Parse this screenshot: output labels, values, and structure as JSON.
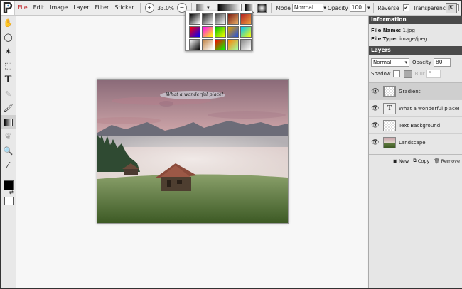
{
  "menubar": {
    "items": [
      "File",
      "Edit",
      "Image",
      "Layer",
      "Filter",
      "Sticker"
    ],
    "zoom": "33.0%",
    "mode_label": "Mode",
    "mode_value": "Normal",
    "opacity_label": "Opacity",
    "opacity_value": "100",
    "reverse_label": "Reverse",
    "transparency_label": "Transparency",
    "check_mark": "✔"
  },
  "photo": {
    "banner_text": "What a wonderful place!"
  },
  "gradients": {
    "swatches": [
      [
        "#000000",
        "#ffffff"
      ],
      [
        "#222222",
        "#eeeeee"
      ],
      [
        "#444444",
        "#ffffff"
      ],
      [
        "#7a1a10",
        "#e8b06a"
      ],
      [
        "#b02020",
        "#f0a040"
      ],
      [
        "#ff0000",
        "#0000ff"
      ],
      [
        "#ff00ff",
        "#ffff00"
      ],
      [
        "#00c000",
        "#ffff00"
      ],
      [
        "#e0a000",
        "#2050e0"
      ],
      [
        "#00c0ff",
        "#ffff00"
      ],
      [
        "#ffffff",
        "#000000"
      ],
      [
        "#c08040",
        "#ffffff"
      ],
      [
        "#ff0000",
        "#00ff00"
      ],
      [
        "#ff8000",
        "#a0ffa0"
      ],
      [
        "#888888",
        "#ffffff"
      ]
    ]
  },
  "panel": {
    "info_title": "Information",
    "file_name_label": "File Name:",
    "file_name": "1.jpg",
    "file_type_label": "File Type:",
    "file_type": "image/jpeg",
    "layers_title": "Layers",
    "blend_mode": "Normal",
    "opacity_label": "Opacity",
    "opacity_value": "80",
    "shadow_label": "Shadow",
    "blur_label": "Blur",
    "blur_value": "5",
    "layers": [
      {
        "name": "Gradient"
      },
      {
        "name": "What a wonderful place!"
      },
      {
        "name": "Text Background"
      },
      {
        "name": "Landscape"
      }
    ],
    "new_label": "New",
    "copy_label": "Copy",
    "remove_label": "Remove"
  }
}
